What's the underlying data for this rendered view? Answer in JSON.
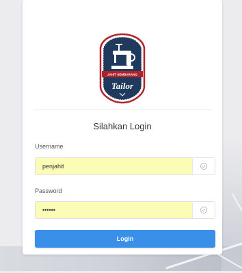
{
  "logo": {
    "ribbon_text": "JAHIT SEMBARANG",
    "brand_text": "Tailor"
  },
  "form": {
    "title": "Silahkan Login",
    "username_label": "Username",
    "username_value": "penjahit",
    "password_label": "Password",
    "password_value": "••••••",
    "submit_label": "Login"
  },
  "icons": {
    "username_addon": "check-circle-icon",
    "password_addon": "check-circle-icon"
  },
  "colors": {
    "primary": "#3a8fe8",
    "autofill": "#fbfdb6",
    "badge_red": "#b3242a",
    "badge_navy": "#1f3a5c"
  }
}
